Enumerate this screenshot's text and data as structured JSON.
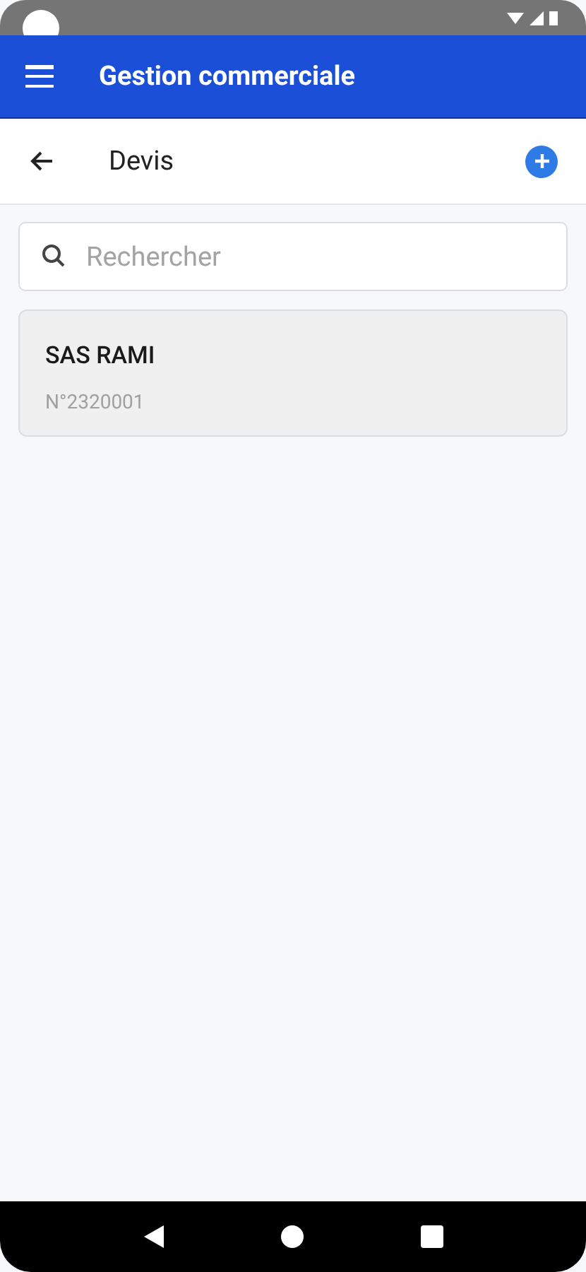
{
  "app_bar": {
    "title": "Gestion commerciale"
  },
  "header": {
    "title": "Devis"
  },
  "search": {
    "placeholder": "Rechercher"
  },
  "quotes": [
    {
      "client": "SAS RAMI",
      "number": "N°2320001"
    }
  ]
}
